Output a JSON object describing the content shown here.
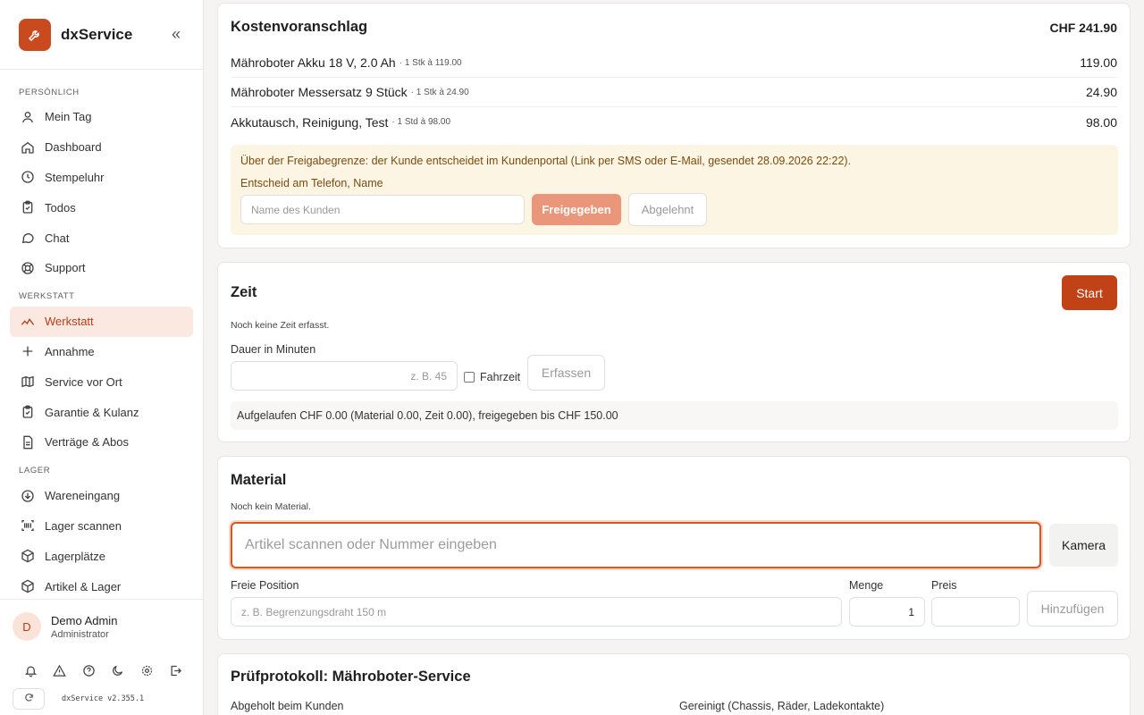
{
  "app": {
    "name": "dxService",
    "version": "dxService v2.355.1"
  },
  "sidebar": {
    "sections": {
      "personal": "PERSÖNLICH",
      "workshop": "WERKSTATT",
      "storage": "LAGER"
    },
    "personal_items": [
      {
        "label": "Mein Tag",
        "icon": "user-icon"
      },
      {
        "label": "Dashboard",
        "icon": "home-icon"
      },
      {
        "label": "Stempeluhr",
        "icon": "clock-icon"
      },
      {
        "label": "Todos",
        "icon": "clipboard-icon"
      },
      {
        "label": "Chat",
        "icon": "chat-icon"
      },
      {
        "label": "Support",
        "icon": "lifebuoy-icon"
      }
    ],
    "workshop_items": [
      {
        "label": "Werkstatt",
        "icon": "wave-icon",
        "active": true
      },
      {
        "label": "Annahme",
        "icon": "plus-icon"
      },
      {
        "label": "Service vor Ort",
        "icon": "map-icon"
      },
      {
        "label": "Garantie & Kulanz",
        "icon": "clipboard-check-icon"
      },
      {
        "label": "Verträge & Abos",
        "icon": "document-icon"
      }
    ],
    "storage_items": [
      {
        "label": "Wareneingang",
        "icon": "download-icon"
      },
      {
        "label": "Lager scannen",
        "icon": "barcode-icon"
      },
      {
        "label": "Lagerplätze",
        "icon": "box-icon"
      },
      {
        "label": "Artikel & Lager",
        "icon": "package-icon"
      }
    ],
    "user": {
      "initial": "D",
      "name": "Demo Admin",
      "role": "Administrator"
    },
    "tools": [
      "bell-icon",
      "warning-icon",
      "help-icon",
      "moon-icon",
      "settings-icon",
      "logout-icon"
    ],
    "accent": "#c24217"
  },
  "quote": {
    "title": "Kostenvoranschlag",
    "total": "CHF 241.90",
    "rows": [
      {
        "name": "Mähroboter Akku 18 V, 2.0 Ah",
        "detail": "· 1 Stk à 119.00",
        "amount": "119.00"
      },
      {
        "name": "Mähroboter Messersatz 9 Stück",
        "detail": "· 1 Stk à 24.90",
        "amount": "24.90"
      },
      {
        "name": "Akkutausch, Reinigung, Test",
        "detail": "· 1 Std à 98.00",
        "amount": "98.00"
      }
    ],
    "approval": {
      "message": "Über der Freigabegrenze: der Kunde entscheidet im Kundenportal (Link per SMS oder E-Mail, gesendet 28.09.2026 22:22).",
      "phone_label": "Entscheid am Telefon, Name",
      "name_placeholder": "Name des Kunden",
      "approve_label": "Freigegeben",
      "reject_label": "Abgelehnt"
    }
  },
  "time": {
    "title": "Zeit",
    "start_label": "Start",
    "empty_text": "Noch keine Zeit erfasst.",
    "duration_label": "Dauer in Minuten",
    "duration_placeholder": "z. B. 45",
    "travel_label": "Fahrzeit",
    "submit_label": "Erfassen",
    "summary": "Aufgelaufen CHF 0.00 (Material 0.00, Zeit 0.00), freigegeben bis CHF 150.00"
  },
  "material": {
    "title": "Material",
    "empty_text": "Noch kein Material.",
    "scan_placeholder": "Artikel scannen oder Nummer eingeben",
    "camera_label": "Kamera",
    "free_label": "Freie Position",
    "free_placeholder": "z. B. Begrenzungsdraht 150 m",
    "qty_label": "Menge",
    "qty_value": "1",
    "price_label": "Preis",
    "add_label": "Hinzufügen"
  },
  "protocol": {
    "title": "Prüfprotokoll: Mähroboter-Service",
    "items": [
      "Abgeholt beim Kunden",
      "Gereinigt (Chassis, Räder, Ladekontakte)"
    ]
  }
}
